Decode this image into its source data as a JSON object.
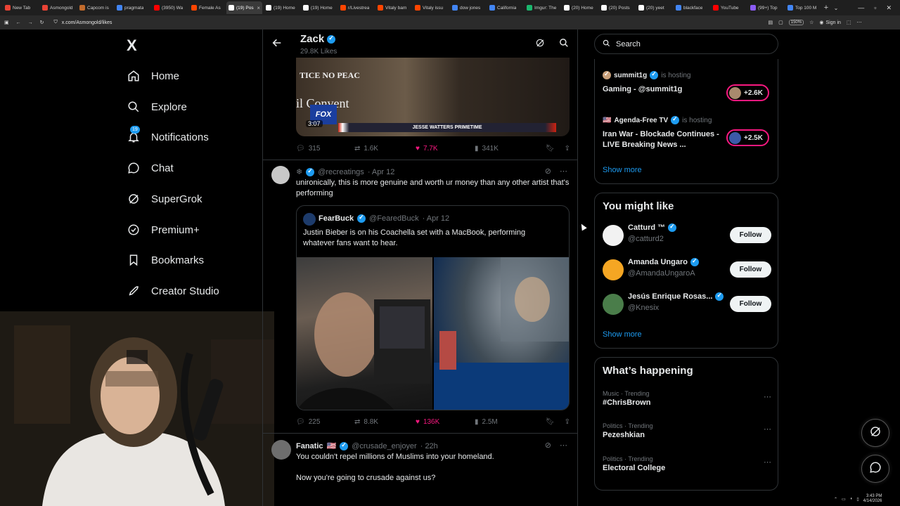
{
  "browser": {
    "tabs": [
      {
        "label": "New Tab",
        "color": "#ea4335"
      },
      {
        "label": "Asmongold",
        "color": "#ea4335"
      },
      {
        "label": "Capcom is",
        "color": "#c26b2c"
      },
      {
        "label": "pragmata",
        "color": "#4285f4"
      },
      {
        "label": "(3950) Wa",
        "color": "#ff0000"
      },
      {
        "label": "Female As",
        "color": "#ff4500"
      },
      {
        "label": "(19) Pos",
        "color": "#ffffff",
        "active": true
      },
      {
        "label": "(19) Home",
        "color": "#ffffff"
      },
      {
        "label": "(19) Home",
        "color": "#ffffff"
      },
      {
        "label": "r/Livestrea",
        "color": "#ff4500"
      },
      {
        "label": "Vitaly bam",
        "color": "#ff4500"
      },
      {
        "label": "Vitaly issu",
        "color": "#ff4500"
      },
      {
        "label": "dow jones",
        "color": "#4285f4"
      },
      {
        "label": "California",
        "color": "#4285f4"
      },
      {
        "label": "Imgur: The",
        "color": "#1bb76e"
      },
      {
        "label": "(20) Home",
        "color": "#ffffff"
      },
      {
        "label": "(20) Posts",
        "color": "#ffffff"
      },
      {
        "label": "(20) yeet",
        "color": "#ffffff"
      },
      {
        "label": "blackface",
        "color": "#4285f4"
      },
      {
        "label": "YouTube",
        "color": "#ff0000"
      },
      {
        "label": "(99+) Top",
        "color": "#8b5cf6"
      },
      {
        "label": "Top 100 M",
        "color": "#4285f4"
      }
    ],
    "url": "x.com/Asmongold/likes",
    "zoom": "150%",
    "sign_in": "Sign in"
  },
  "sidebar": {
    "logo": "X",
    "items": [
      {
        "label": "Home",
        "icon": "home-icon"
      },
      {
        "label": "Explore",
        "icon": "search-icon"
      },
      {
        "label": "Notifications",
        "icon": "bell-icon",
        "badge": "19"
      },
      {
        "label": "Chat",
        "icon": "chat-icon"
      },
      {
        "label": "SuperGrok",
        "icon": "grok-icon"
      },
      {
        "label": "Premium+",
        "icon": "premium-icon"
      },
      {
        "label": "Bookmarks",
        "icon": "bookmark-icon"
      },
      {
        "label": "Creator Studio",
        "icon": "rocket-icon"
      }
    ]
  },
  "main": {
    "title": "Zack",
    "subtitle": "29.8K Likes",
    "video": {
      "duration": "3:07",
      "overlay_top": "TICE NO PEAC",
      "overlay_mid": "il Convent",
      "bug": "FOX",
      "chyron": "JESSE WATTERS PRIMETIME"
    },
    "tweet1_actions": {
      "replies": "315",
      "reposts": "1.6K",
      "likes": "7.7K",
      "views": "341K"
    },
    "tweet2": {
      "handle": "@recreatings",
      "date": "· Apr 12",
      "text": "unironically, this is more genuine and worth ur money than any other artist that's performing",
      "quote": {
        "name": "FearBuck",
        "handle": "@FearedBuck",
        "date": "· Apr 12",
        "text": "Justin Bieber is on his Coachella set with a MacBook, performing whatever fans want to hear."
      },
      "actions": {
        "replies": "225",
        "reposts": "8.8K",
        "likes": "136K",
        "views": "2.5M"
      }
    },
    "tweet3": {
      "name": "Fanatic",
      "flag": "🇺🇸",
      "handle": "@crusade_enjoyer",
      "date": "· 22h",
      "line1": "You couldn't repel millions of Muslims into your homeland.",
      "line2": "Now you're going to crusade against us?"
    }
  },
  "right": {
    "search_placeholder": "Search",
    "spaces": [
      {
        "host": "summit1g",
        "hosting": "is hosting",
        "title": "Gaming - @summit1g",
        "count": "+2.6K"
      },
      {
        "host": "Agenda-Free TV",
        "hosting": "is hosting",
        "title": "Iran War - Blockade Continues - LIVE Breaking News ...",
        "count": "+2.5K"
      }
    ],
    "spaces_show_more": "Show more",
    "wtf_title": "You might like",
    "wtf": [
      {
        "name": "Catturd ™",
        "handle": "@catturd2",
        "button": "Follow",
        "color": "#f2f2f2"
      },
      {
        "name": "Amanda Ungaro",
        "handle": "@AmandaUngaroA",
        "button": "Follow",
        "color": "#f5a623"
      },
      {
        "name": "Jesús Enrique Rosas...",
        "handle": "@Knesix",
        "button": "Follow",
        "color": "#4a7d4a"
      }
    ],
    "wtf_show_more": "Show more",
    "happening_title": "What’s happening",
    "trends": [
      {
        "category": "Music · Trending",
        "topic": "#ChrisBrown"
      },
      {
        "category": "Politics · Trending",
        "topic": "Pezeshkian"
      },
      {
        "category": "Politics · Trending",
        "topic": "Electoral College"
      }
    ]
  },
  "taskbar": {
    "time": "3:43 PM",
    "date": "4/14/2026"
  },
  "colors": {
    "accent": "#1d9bf0",
    "like": "#f91880",
    "border": "#2f3336",
    "muted": "#71767b"
  }
}
